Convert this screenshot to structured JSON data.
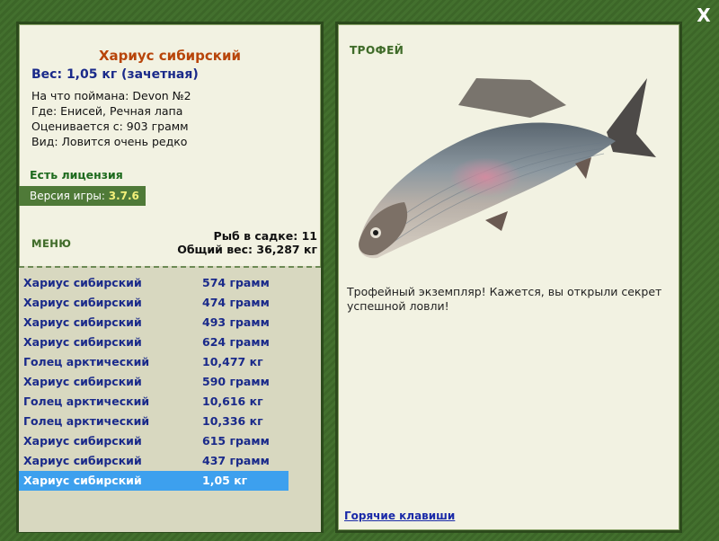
{
  "close_label": "X",
  "fish_card": {
    "title": "Хариус сибирский",
    "weight": "Вес: 1,05 кг (зачетная)",
    "caught_with": "На что поймана: Devon №2",
    "where": "Где: Енисей, Речная лапа",
    "valued_from": "Оценивается с: 903 грамм",
    "kind": "Вид: Ловится очень редко",
    "license": "Есть лицензия",
    "version_label": "Версия игры: ",
    "version_value": "3.7.6"
  },
  "menu_label": "МЕНЮ",
  "cage": {
    "count": "Рыб в садке: 11",
    "total": "Общий вес: 36,287 кг"
  },
  "catch_list": [
    {
      "name": "Хариус сибирский",
      "weight": "574 грамм",
      "selected": false
    },
    {
      "name": "Хариус сибирский",
      "weight": "474 грамм",
      "selected": false
    },
    {
      "name": "Хариус сибирский",
      "weight": "493 грамм",
      "selected": false
    },
    {
      "name": "Хариус сибирский",
      "weight": "624 грамм",
      "selected": false
    },
    {
      "name": "Голец арктический",
      "weight": "10,477 кг",
      "selected": false
    },
    {
      "name": "Хариус сибирский",
      "weight": "590 грамм",
      "selected": false
    },
    {
      "name": "Голец арктический",
      "weight": "10,616 кг",
      "selected": false
    },
    {
      "name": "Голец арктический",
      "weight": "10,336 кг",
      "selected": false
    },
    {
      "name": "Хариус сибирский",
      "weight": "615 грамм",
      "selected": false
    },
    {
      "name": "Хариус сибирский",
      "weight": "437 грамм",
      "selected": false
    },
    {
      "name": "Хариус сибирский",
      "weight": "1,05 кг",
      "selected": true
    }
  ],
  "trophy_panel": {
    "label": "ТРОФЕЙ",
    "description": "Трофейный экземпляр! Кажется, вы открыли секрет успешной ловли!",
    "hotkeys_link": "Горячие клавиши"
  },
  "colors": {
    "frame": "#3f6a2a",
    "panel": "#f2f2e2",
    "selected_row": "#3da0ee",
    "title": "#b8450a",
    "list_text": "#1a2a8a"
  }
}
